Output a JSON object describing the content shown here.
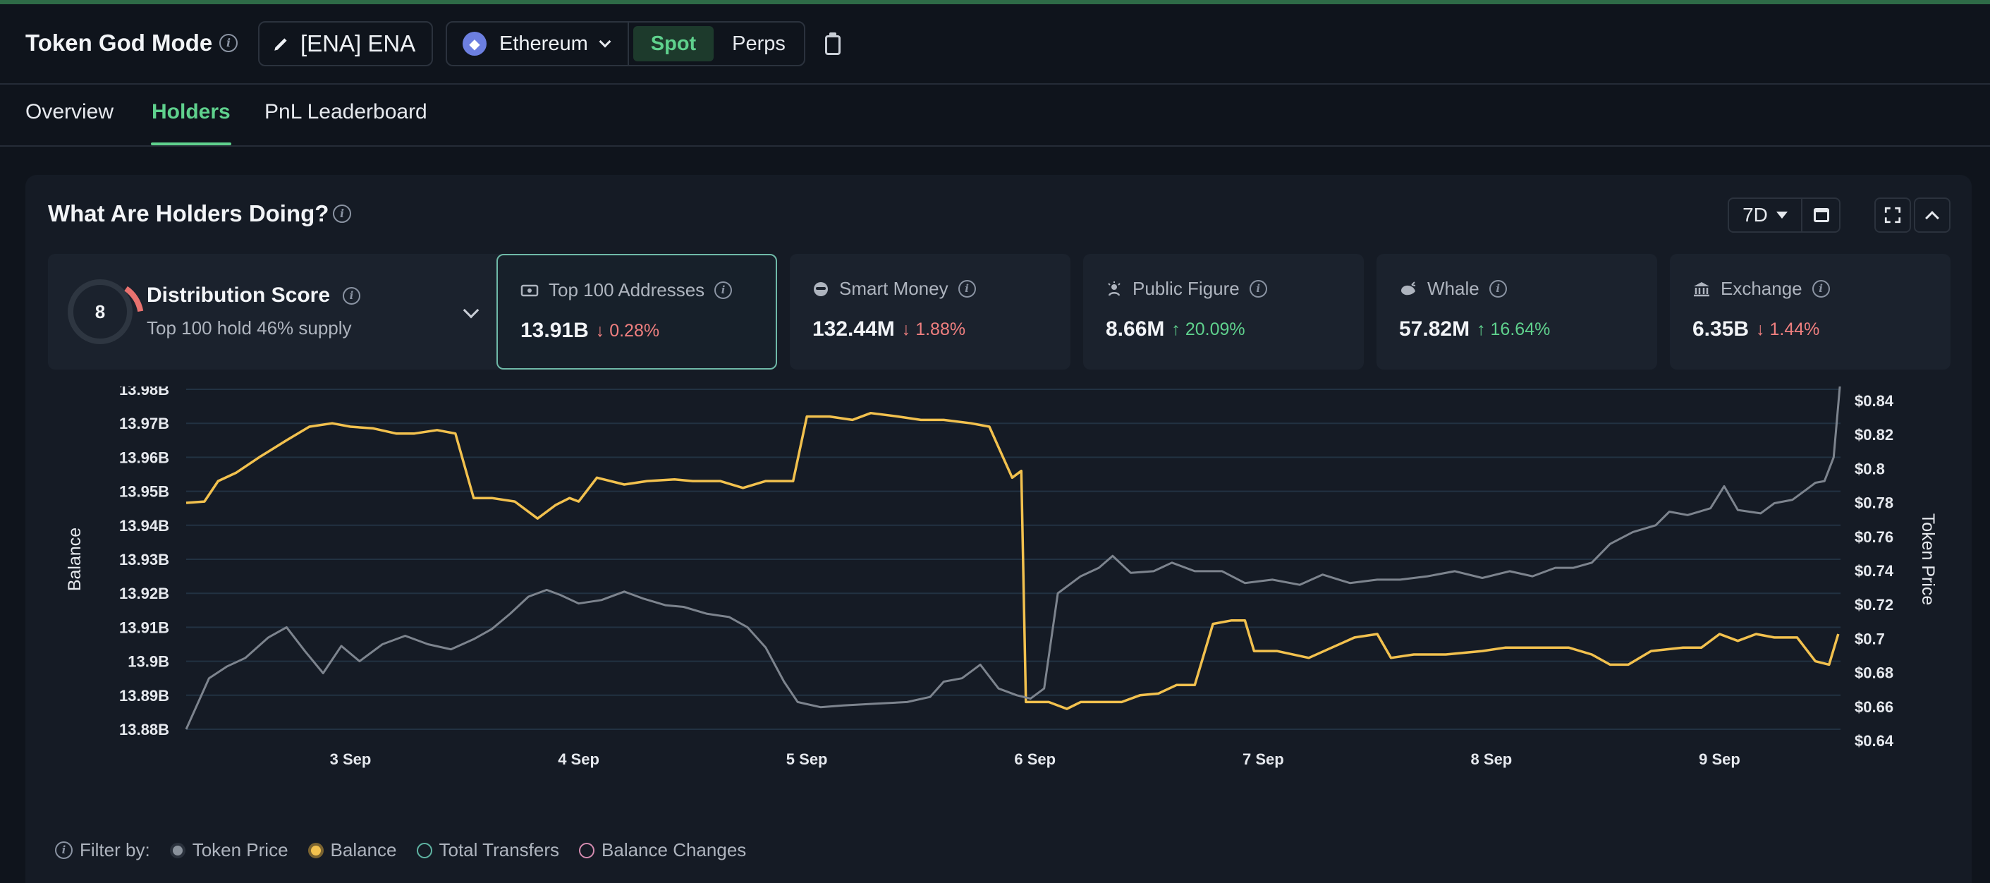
{
  "header": {
    "title": "Token God Mode",
    "token_label": "[ENA] ENA",
    "chain_label": "Ethereum",
    "mode_spot": "Spot",
    "mode_perps": "Perps"
  },
  "tabs": [
    {
      "label": "Overview"
    },
    {
      "label": "Holders"
    },
    {
      "label": "PnL Leaderboard"
    }
  ],
  "card": {
    "title": "What Are Holders Doing?",
    "range": "7D"
  },
  "distribution": {
    "score": "8",
    "title": "Distribution Score",
    "subtitle": "Top 100 hold 46% supply"
  },
  "stats": [
    {
      "label": "Top 100 Addresses",
      "value": "13.91B",
      "change": "0.28%",
      "dir": "down",
      "icon": "cash-icon"
    },
    {
      "label": "Smart Money",
      "value": "132.44M",
      "change": "1.88%",
      "dir": "down",
      "icon": "glasses-icon"
    },
    {
      "label": "Public Figure",
      "value": "8.66M",
      "change": "20.09%",
      "dir": "up",
      "icon": "star-person-icon"
    },
    {
      "label": "Whale",
      "value": "57.82M",
      "change": "16.64%",
      "dir": "up",
      "icon": "whale-icon"
    },
    {
      "label": "Exchange",
      "value": "6.35B",
      "change": "1.44%",
      "dir": "down",
      "icon": "bank-icon"
    }
  ],
  "chart_data": {
    "type": "line",
    "ylabel_left": "Balance",
    "ylabel_right": "Token Price",
    "left_ticks": [
      "13.98B",
      "13.97B",
      "13.96B",
      "13.95B",
      "13.94B",
      "13.93B",
      "13.92B",
      "13.91B",
      "13.9B",
      "13.89B",
      "13.88B"
    ],
    "right_ticks": [
      "$0.84",
      "$0.82",
      "$0.8",
      "$0.78",
      "$0.76",
      "$0.74",
      "$0.72",
      "$0.7",
      "$0.68",
      "$0.66",
      "$0.64"
    ],
    "ylim_left": [
      13.88,
      13.98
    ],
    "ylim_right": [
      0.64,
      0.84
    ],
    "x_ticks": [
      {
        "label": "3 Sep",
        "x": 1
      },
      {
        "label": "4 Sep",
        "x": 2
      },
      {
        "label": "5 Sep",
        "x": 3
      },
      {
        "label": "6 Sep",
        "x": 4
      },
      {
        "label": "7 Sep",
        "x": 5
      },
      {
        "label": "8 Sep",
        "x": 6
      },
      {
        "label": "9 Sep",
        "x": 7
      }
    ],
    "xlim": [
      0.28,
      7.53
    ],
    "series": [
      {
        "name": "Balance",
        "color": "#f2c14e",
        "axis": "left",
        "points": [
          [
            0.28,
            13.9466
          ],
          [
            0.36,
            13.947
          ],
          [
            0.42,
            13.953
          ],
          [
            0.5,
            13.9555
          ],
          [
            0.6,
            13.96
          ],
          [
            0.72,
            13.965
          ],
          [
            0.82,
            13.969
          ],
          [
            0.92,
            13.97
          ],
          [
            1.0,
            13.969
          ],
          [
            1.1,
            13.9685
          ],
          [
            1.2,
            13.967
          ],
          [
            1.28,
            13.967
          ],
          [
            1.38,
            13.968
          ],
          [
            1.46,
            13.967
          ],
          [
            1.54,
            13.948
          ],
          [
            1.62,
            13.948
          ],
          [
            1.72,
            13.947
          ],
          [
            1.82,
            13.942
          ],
          [
            1.9,
            13.946
          ],
          [
            1.96,
            13.948
          ],
          [
            2.0,
            13.947
          ],
          [
            2.08,
            13.954
          ],
          [
            2.2,
            13.952
          ],
          [
            2.3,
            13.953
          ],
          [
            2.42,
            13.9535
          ],
          [
            2.5,
            13.953
          ],
          [
            2.62,
            13.953
          ],
          [
            2.72,
            13.951
          ],
          [
            2.82,
            13.953
          ],
          [
            2.94,
            13.953
          ],
          [
            3.0,
            13.972
          ],
          [
            3.1,
            13.972
          ],
          [
            3.2,
            13.971
          ],
          [
            3.28,
            13.973
          ],
          [
            3.4,
            13.972
          ],
          [
            3.5,
            13.971
          ],
          [
            3.6,
            13.971
          ],
          [
            3.72,
            13.97
          ],
          [
            3.8,
            13.969
          ],
          [
            3.86,
            13.96
          ],
          [
            3.9,
            13.954
          ],
          [
            3.94,
            13.956
          ],
          [
            3.96,
            13.888
          ],
          [
            4.06,
            13.888
          ],
          [
            4.14,
            13.886
          ],
          [
            4.2,
            13.888
          ],
          [
            4.3,
            13.888
          ],
          [
            4.38,
            13.888
          ],
          [
            4.46,
            13.89
          ],
          [
            4.54,
            13.8905
          ],
          [
            4.62,
            13.893
          ],
          [
            4.7,
            13.893
          ],
          [
            4.78,
            13.911
          ],
          [
            4.86,
            13.912
          ],
          [
            4.92,
            13.912
          ],
          [
            4.96,
            13.903
          ],
          [
            5.06,
            13.903
          ],
          [
            5.2,
            13.901
          ],
          [
            5.3,
            13.904
          ],
          [
            5.4,
            13.907
          ],
          [
            5.5,
            13.908
          ],
          [
            5.56,
            13.901
          ],
          [
            5.66,
            13.902
          ],
          [
            5.8,
            13.902
          ],
          [
            5.96,
            13.903
          ],
          [
            6.06,
            13.904
          ],
          [
            6.2,
            13.904
          ],
          [
            6.34,
            13.904
          ],
          [
            6.44,
            13.902
          ],
          [
            6.52,
            13.899
          ],
          [
            6.6,
            13.899
          ],
          [
            6.7,
            13.903
          ],
          [
            6.84,
            13.904
          ],
          [
            6.92,
            13.904
          ],
          [
            7.0,
            13.908
          ],
          [
            7.08,
            13.906
          ],
          [
            7.16,
            13.908
          ],
          [
            7.24,
            13.907
          ],
          [
            7.34,
            13.907
          ],
          [
            7.42,
            13.9
          ],
          [
            7.48,
            13.899
          ],
          [
            7.52,
            13.908
          ]
        ]
      },
      {
        "name": "Token Price",
        "color": "#7d848e",
        "axis": "right",
        "points": [
          [
            0.28,
            0.64
          ],
          [
            0.38,
            0.67
          ],
          [
            0.46,
            0.677
          ],
          [
            0.54,
            0.682
          ],
          [
            0.64,
            0.694
          ],
          [
            0.72,
            0.7
          ],
          [
            0.8,
            0.686
          ],
          [
            0.88,
            0.673
          ],
          [
            0.96,
            0.689
          ],
          [
            1.04,
            0.68
          ],
          [
            1.14,
            0.69
          ],
          [
            1.24,
            0.695
          ],
          [
            1.34,
            0.69
          ],
          [
            1.44,
            0.687
          ],
          [
            1.54,
            0.693
          ],
          [
            1.62,
            0.699
          ],
          [
            1.7,
            0.708
          ],
          [
            1.78,
            0.718
          ],
          [
            1.86,
            0.722
          ],
          [
            1.92,
            0.719
          ],
          [
            2.0,
            0.714
          ],
          [
            2.1,
            0.716
          ],
          [
            2.2,
            0.721
          ],
          [
            2.28,
            0.717
          ],
          [
            2.38,
            0.713
          ],
          [
            2.46,
            0.712
          ],
          [
            2.56,
            0.708
          ],
          [
            2.66,
            0.706
          ],
          [
            2.74,
            0.7
          ],
          [
            2.82,
            0.688
          ],
          [
            2.9,
            0.668
          ],
          [
            2.96,
            0.656
          ],
          [
            3.06,
            0.653
          ],
          [
            3.16,
            0.654
          ],
          [
            3.3,
            0.655
          ],
          [
            3.44,
            0.656
          ],
          [
            3.54,
            0.659
          ],
          [
            3.6,
            0.668
          ],
          [
            3.68,
            0.67
          ],
          [
            3.76,
            0.678
          ],
          [
            3.84,
            0.664
          ],
          [
            3.92,
            0.66
          ],
          [
            3.98,
            0.658
          ],
          [
            4.04,
            0.664
          ],
          [
            4.1,
            0.72
          ],
          [
            4.2,
            0.73
          ],
          [
            4.28,
            0.735
          ],
          [
            4.34,
            0.742
          ],
          [
            4.42,
            0.732
          ],
          [
            4.52,
            0.733
          ],
          [
            4.6,
            0.738
          ],
          [
            4.7,
            0.733
          ],
          [
            4.82,
            0.733
          ],
          [
            4.92,
            0.726
          ],
          [
            5.04,
            0.728
          ],
          [
            5.16,
            0.725
          ],
          [
            5.26,
            0.731
          ],
          [
            5.38,
            0.726
          ],
          [
            5.5,
            0.728
          ],
          [
            5.6,
            0.728
          ],
          [
            5.72,
            0.73
          ],
          [
            5.84,
            0.733
          ],
          [
            5.96,
            0.729
          ],
          [
            6.08,
            0.733
          ],
          [
            6.18,
            0.73
          ],
          [
            6.28,
            0.735
          ],
          [
            6.36,
            0.735
          ],
          [
            6.44,
            0.738
          ],
          [
            6.52,
            0.749
          ],
          [
            6.62,
            0.756
          ],
          [
            6.72,
            0.76
          ],
          [
            6.78,
            0.768
          ],
          [
            6.86,
            0.766
          ],
          [
            6.96,
            0.77
          ],
          [
            7.02,
            0.783
          ],
          [
            7.08,
            0.769
          ],
          [
            7.18,
            0.767
          ],
          [
            7.24,
            0.773
          ],
          [
            7.32,
            0.775
          ],
          [
            7.38,
            0.781
          ],
          [
            7.42,
            0.785
          ],
          [
            7.46,
            0.786
          ],
          [
            7.5,
            0.8
          ],
          [
            7.53,
            0.846
          ]
        ]
      }
    ],
    "legend": {
      "prefix": "Filter by:",
      "items": [
        {
          "label": "Token Price",
          "color": "#8a929c",
          "filled": true
        },
        {
          "label": "Balance",
          "color": "#f2c14e",
          "filled": true
        },
        {
          "label": "Total Transfers",
          "color": "#5fb4a3",
          "filled": false
        },
        {
          "label": "Balance Changes",
          "color": "#d48bb0",
          "filled": false
        }
      ]
    }
  }
}
